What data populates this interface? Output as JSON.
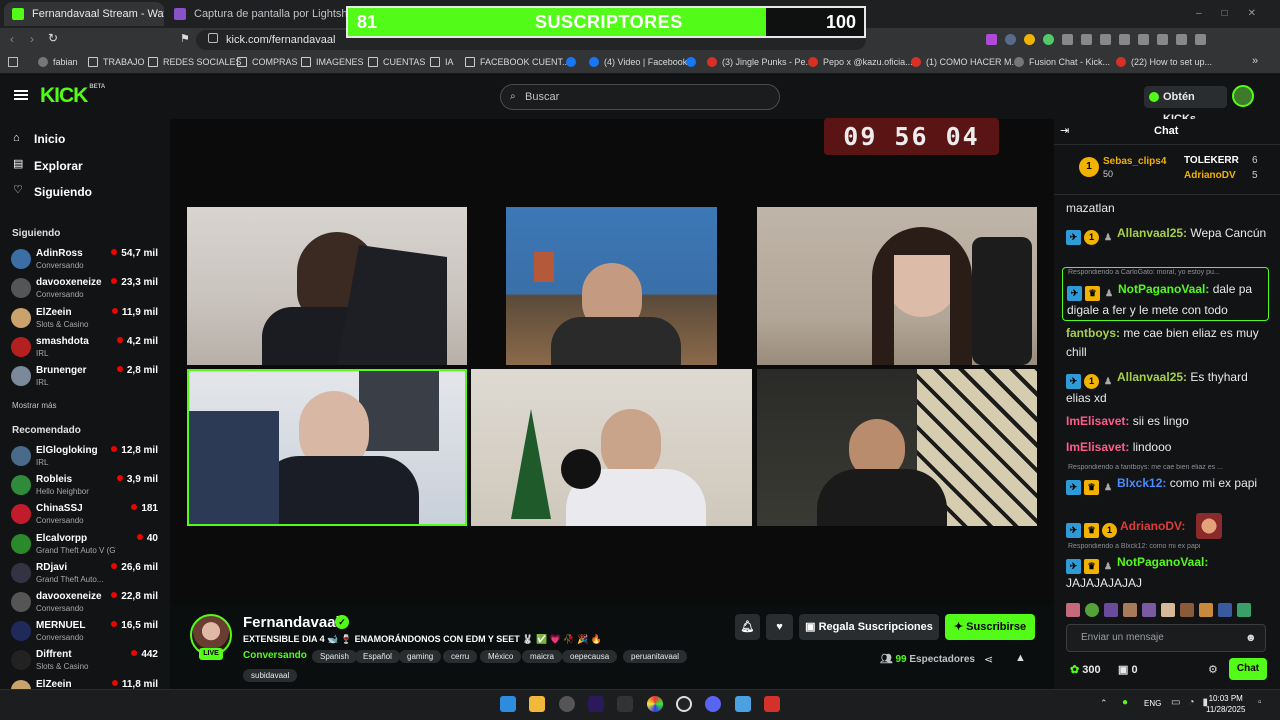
{
  "browser": {
    "tabs": [
      {
        "label": "Fernandavaal Stream - Watch Li...",
        "active": true
      },
      {
        "label": "Captura de pantalla por Lightshot",
        "active": false
      }
    ],
    "url": "kick.com/fernandavaal",
    "bookmarks": [
      {
        "label": "fabian",
        "icon": "globe-icon"
      },
      {
        "label": "TRABAJO",
        "icon": "folder-icon"
      },
      {
        "label": "REDES SOCIALES",
        "icon": "folder-icon"
      },
      {
        "label": "COMPRAS",
        "icon": "folder-icon"
      },
      {
        "label": "IMAGENES",
        "icon": "folder-icon"
      },
      {
        "label": "CUENTAS",
        "icon": "folder-icon"
      },
      {
        "label": "IA",
        "icon": "folder-icon"
      },
      {
        "label": "FACEBOOK CUENT...",
        "icon": "folder-icon"
      },
      {
        "label": "",
        "icon": "circle-icon"
      },
      {
        "label": "(4) Video | Facebook",
        "icon": "facebook-icon"
      },
      {
        "label": "",
        "icon": "facebook-icon"
      },
      {
        "label": "(3) Jingle Punks - Pe...",
        "icon": "youtube-icon"
      },
      {
        "label": "Pepo x @kazu.oficia...",
        "icon": "youtube-icon"
      },
      {
        "label": "(1) COMO HACER M...",
        "icon": "youtube-icon"
      },
      {
        "label": "Fusion Chat - Kick...",
        "icon": "kick-icon"
      },
      {
        "label": "(22) How to set up...",
        "icon": "youtube-icon"
      }
    ]
  },
  "overlay": {
    "sub_count": "81",
    "label": "SUSCRIPTORES",
    "goal": "100",
    "progress": 0.81,
    "color": "#53fc18"
  },
  "header": {
    "logo": "KICK",
    "logo_tag": "BETA",
    "search_placeholder": "Buscar",
    "get_kicks": "Obtén KICKs"
  },
  "sidebar": {
    "nav": [
      {
        "label": "Inicio",
        "icon": "home-icon"
      },
      {
        "label": "Explorar",
        "icon": "compass-icon"
      },
      {
        "label": "Siguiendo",
        "icon": "heart-icon"
      }
    ],
    "following_title": "Siguiendo",
    "following": [
      {
        "name": "AdinRoss",
        "category": "Conversando",
        "viewers": "54,7 mil",
        "color": "#3a6ea5"
      },
      {
        "name": "davooxeneize",
        "category": "Conversando",
        "viewers": "23,3 mil",
        "color": "#555"
      },
      {
        "name": "ElZeein",
        "category": "Slots & Casino",
        "viewers": "11,9 mil",
        "color": "#c9a36b"
      },
      {
        "name": "smashdota",
        "category": "IRL",
        "viewers": "4,2 mil",
        "color": "#b32020"
      },
      {
        "name": "Brunenger",
        "category": "IRL",
        "viewers": "2,8 mil",
        "color": "#7a8a9a"
      }
    ],
    "show_more": "Mostrar más",
    "recommended_title": "Recomendado",
    "recommended": [
      {
        "name": "ElGlogloking",
        "category": "IRL",
        "viewers": "12,8 mil",
        "color": "#4a6a8a"
      },
      {
        "name": "Robleis",
        "category": "Hello Neighbor",
        "viewers": "3,9 mil",
        "color": "#2f8a3a"
      },
      {
        "name": "ChinaSSJ",
        "category": "Conversando",
        "viewers": "181",
        "color": "#c21c2c"
      },
      {
        "name": "Elcalvorpp",
        "category": "Grand Theft Auto V (GTA)",
        "viewers": "40",
        "color": "#2a8a2a"
      },
      {
        "name": "RDjavi",
        "category": "Grand Theft Auto...",
        "viewers": "26,6 mil",
        "color": "#334"
      },
      {
        "name": "davooxeneize",
        "category": "Conversando",
        "viewers": "22,8 mil",
        "color": "#555"
      },
      {
        "name": "MERNUEL",
        "category": "Conversando",
        "viewers": "16,5 mil",
        "color": "#1e2a5a"
      },
      {
        "name": "Diffrent",
        "category": "Slots & Casino",
        "viewers": "442",
        "color": "#222"
      },
      {
        "name": "ElZeein",
        "category": "",
        "viewers": "11,8 mil",
        "color": "#c9a36b"
      }
    ]
  },
  "stream": {
    "timer": "09 56 04",
    "streamer": "Fernandavaal",
    "title": "EXTENSIBLE DIA 4 🐋 🍷 ENAMORÁNDONOS CON EDM Y SEET 🐰 ✅ 💗 🥀 🎉 🔥",
    "category": "Conversando",
    "tags": [
      "Spanish",
      "Español",
      "gaming",
      "cerru",
      "México",
      "maicra",
      "oepecausa",
      "peruanitavaal",
      "subidavaal"
    ],
    "live": "LIVE",
    "gift_subs": "Regala Suscripciones",
    "subscribe": "Suscribirse",
    "viewers": "99",
    "viewers_label": "Espectadores"
  },
  "chat": {
    "title": "Chat",
    "leaderboard": [
      {
        "name": "Sebas_clips4",
        "value": "50"
      },
      {
        "name": "TOLEKERR",
        "value": "6"
      },
      {
        "name": "AdrianoDV",
        "value": "5"
      }
    ],
    "messages": [
      {
        "reply": "",
        "user": "",
        "text": "mazatlan",
        "color": "#e7e9ea"
      },
      {
        "reply": "",
        "user": "Allanvaal25:",
        "text": " Wepa Cancún",
        "color": "#a6d04a"
      },
      {
        "reply": "Respondiendo a CarloGato: moral, yo estoy pu...",
        "user": "NotPaganoVaal:",
        "text": " dale pa digale a fer y le mete con todo",
        "color": "#53fc18"
      },
      {
        "reply": "",
        "user": "fantboys:",
        "text": " me cae bien eliaz es muy chill",
        "color": "#a6d04a"
      },
      {
        "reply": "",
        "user": "Allanvaal25:",
        "text": " Es thyhard elias xd",
        "color": "#a6d04a"
      },
      {
        "reply": "",
        "user": "ImElisavet:",
        "text": " sii es lingo",
        "color": "#ff5c8a"
      },
      {
        "reply": "",
        "user": "ImElisavet:",
        "text": " lindooo",
        "color": "#ff5c8a"
      },
      {
        "reply": "Respondiendo a fantboys: me cae bien eliaz es ...",
        "user": "Blxck12:",
        "text": " como mi ex papi",
        "color": "#4a8cff"
      },
      {
        "reply": "",
        "user": "AdrianoDV:",
        "text": "",
        "color": "#e03a3a"
      },
      {
        "reply": "Respondiendo a Blxck12: como mi ex papi",
        "user": "NotPaganoVaal:",
        "text": " JAJAJAJAJAJ",
        "color": "#53fc18"
      }
    ],
    "input_placeholder": "Enviar un mensaje",
    "points": "300",
    "gifts": "0",
    "send_label": "Chat"
  },
  "taskbar": {
    "lang": "ENG",
    "time": "10:03 PM",
    "date": "11/28/2025"
  }
}
